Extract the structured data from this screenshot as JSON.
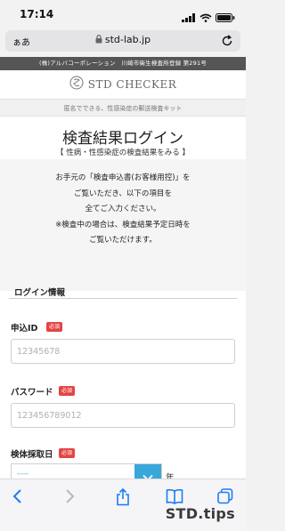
{
  "status_bar": {
    "time": "17:14"
  },
  "browser": {
    "text_size_label": "ぁあ",
    "url": "std-lab.jp"
  },
  "header": {
    "company_line": "(株)アルバコーポレーション　川崎市衛生検査所登録 第291号",
    "logo_text": "STD CHECKER",
    "tagline": "匿名でできる、性感染症の郵送検査キット"
  },
  "page": {
    "title": "検査結果ログイン",
    "subtitle": "【 性病・性感染症の検査結果をみる 】",
    "notice_lines": [
      "お手元の「検査申込書(お客様用控)」を",
      "ご覧いただき、以下の項目を",
      "全てご入力ください。",
      "※検査中の場合は、検査結果予定日時を",
      "ご覧いただけます。"
    ]
  },
  "form": {
    "section_title": "ログイン情報",
    "required_badge": "必須",
    "application_id": {
      "label": "申込ID",
      "placeholder": "12345678"
    },
    "password": {
      "label": "パスワード",
      "placeholder": "123456789012"
    },
    "sample_date": {
      "label": "検体採取日",
      "value": "----",
      "year_suffix": "年"
    }
  },
  "watermark": "STD.tips",
  "colors": {
    "accent": "#39a7dc",
    "required": "#e44444",
    "ios_blue": "#1a7cf5"
  }
}
